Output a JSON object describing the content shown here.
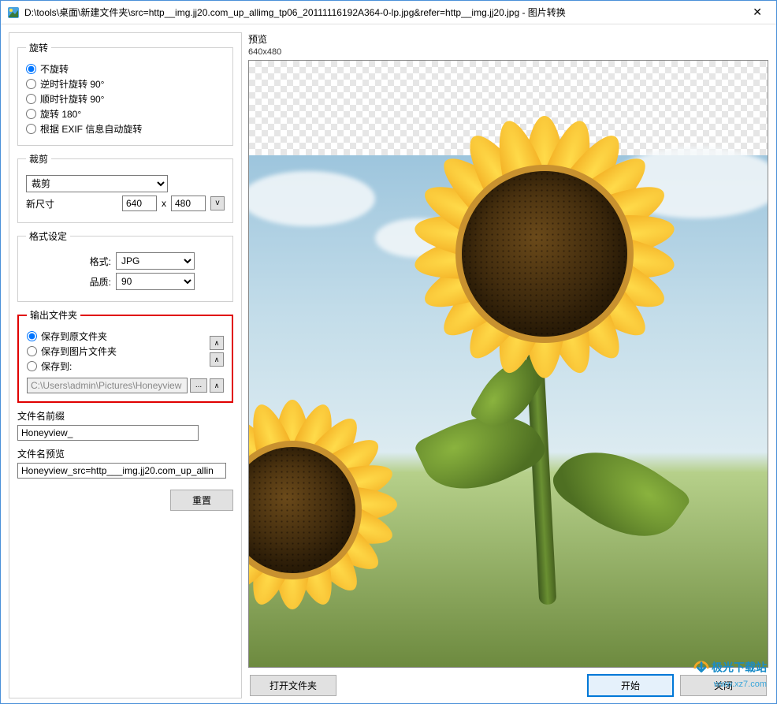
{
  "titlebar": {
    "text": "D:\\tools\\桌面\\新建文件夹\\src=http__img.jj20.com_up_allimg_tp06_20111116192A364-0-lp.jpg&refer=http__img.jj20.jpg - 图片转换"
  },
  "rotate": {
    "legend": "旋转",
    "opt_none": "不旋转",
    "opt_ccw90": "逆时针旋转 90°",
    "opt_cw90": "顺时针旋转 90°",
    "opt_180": "旋转 180°",
    "opt_exif": "根据 EXIF 信息自动旋转"
  },
  "crop": {
    "legend": "裁剪",
    "mode": "裁剪",
    "newsize_label": "新尺寸",
    "width": "640",
    "x": "x",
    "height": "480",
    "v": "v"
  },
  "format": {
    "legend": "格式设定",
    "fmt_label": "格式:",
    "fmt_value": "JPG",
    "quality_label": "品质:",
    "quality_value": "90"
  },
  "output": {
    "legend": "输出文件夹",
    "opt_orig": "保存到原文件夹",
    "opt_pictures": "保存到图片文件夹",
    "opt_custom": "保存到:",
    "path": "C:\\Users\\admin\\Pictures\\Honeyview",
    "browse": "..."
  },
  "prefix": {
    "label": "文件名前缀",
    "value": "Honeyview_"
  },
  "preview_name": {
    "label": "文件名预览",
    "value": "Honeyview_src=http___img.jj20.com_up_allin"
  },
  "reset": "重置",
  "preview": {
    "label": "预览",
    "dims": "640x480"
  },
  "bottom": {
    "open_folder": "打开文件夹",
    "start": "开始",
    "close": "关闭"
  },
  "watermark": {
    "line1": "极光下载站",
    "line2": "www.xz7.com"
  }
}
